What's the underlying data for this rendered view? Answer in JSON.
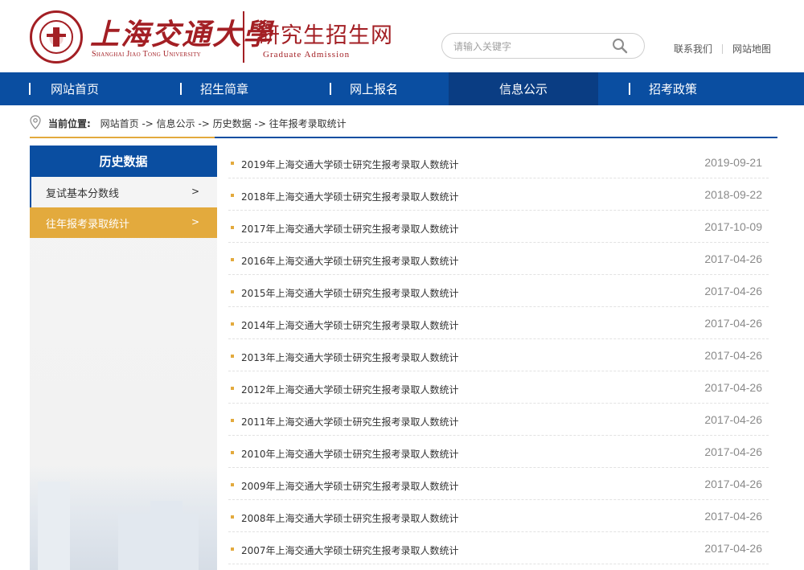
{
  "header": {
    "logo_cn": "上海交通大學",
    "logo_en": "Shanghai Jiao Tong University",
    "site_cn": "研究生招生网",
    "site_en": "Graduate Admission",
    "search_placeholder": "请输入关键字",
    "links": [
      "联系我们",
      "网站地图"
    ]
  },
  "nav": {
    "items": [
      "网站首页",
      "招生简章",
      "网上报名",
      "信息公示",
      "招考政策"
    ],
    "active_index": 3
  },
  "breadcrumb": {
    "label": "当前位置:",
    "path": "网站首页 -> 信息公示 -> 历史数据 -> 往年报考录取统计"
  },
  "sidebar": {
    "title": "历史数据",
    "items": [
      {
        "label": "复试基本分数线",
        "arrow": ">"
      },
      {
        "label": "往年报考录取统计",
        "arrow": ">",
        "active": true
      }
    ]
  },
  "list": [
    {
      "title": "2019年上海交通大学硕士研究生报考录取人数统计",
      "date": "2019-09-21"
    },
    {
      "title": "2018年上海交通大学硕士研究生报考录取人数统计",
      "date": "2018-09-22"
    },
    {
      "title": "2017年上海交通大学硕士研究生报考录取人数统计",
      "date": "2017-10-09"
    },
    {
      "title": "2016年上海交通大学硕士研究生报考录取人数统计",
      "date": "2017-04-26"
    },
    {
      "title": "2015年上海交通大学硕士研究生报考录取人数统计",
      "date": "2017-04-26"
    },
    {
      "title": "2014年上海交通大学硕士研究生报考录取人数统计",
      "date": "2017-04-26"
    },
    {
      "title": "2013年上海交通大学硕士研究生报考录取人数统计",
      "date": "2017-04-26"
    },
    {
      "title": "2012年上海交通大学硕士研究生报考录取人数统计",
      "date": "2017-04-26"
    },
    {
      "title": "2011年上海交通大学硕士研究生报考录取人数统计",
      "date": "2017-04-26"
    },
    {
      "title": "2010年上海交通大学硕士研究生报考录取人数统计",
      "date": "2017-04-26"
    },
    {
      "title": "2009年上海交通大学硕士研究生报考录取人数统计",
      "date": "2017-04-26"
    },
    {
      "title": "2008年上海交通大学硕士研究生报考录取人数统计",
      "date": "2017-04-26"
    },
    {
      "title": "2007年上海交通大学硕士研究生报考录取人数统计",
      "date": "2017-04-26"
    }
  ],
  "colors": {
    "brand_red": "#a31f24",
    "nav_blue": "#0a4ea1",
    "nav_active": "#0a3d83",
    "accent_gold": "#e3aa3d"
  }
}
